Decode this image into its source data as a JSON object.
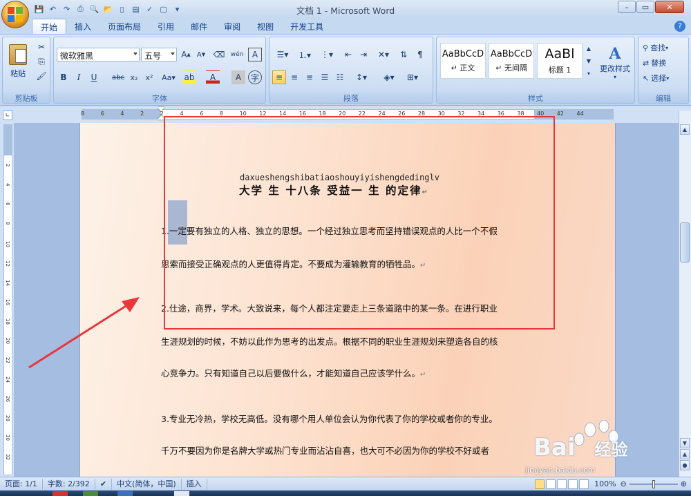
{
  "window": {
    "title": "文档 1 - Microsoft Word"
  },
  "quick_access": {
    "icons": [
      "save-icon",
      "undo-icon",
      "redo-icon",
      "print-icon",
      "print-preview-icon",
      "open-icon",
      "new-icon",
      "doc-icon",
      "spell-icon",
      "page-icon",
      "options-icon"
    ]
  },
  "tabs": [
    "开始",
    "插入",
    "页面布局",
    "引用",
    "邮件",
    "审阅",
    "视图",
    "开发工具"
  ],
  "active_tab": "开始",
  "ribbon": {
    "clipboard": {
      "label": "剪贴板",
      "paste": "粘贴"
    },
    "font": {
      "label": "字体",
      "font_name": "微软雅黑",
      "font_size": "五号"
    },
    "paragraph": {
      "label": "段落"
    },
    "styles": {
      "label": "样式",
      "items": [
        {
          "preview": "AaBbCcD",
          "name": "↵ 正文"
        },
        {
          "preview": "AaBbCcD",
          "name": "↵ 无间隔"
        },
        {
          "preview": "AaBl",
          "name": "标题 1"
        }
      ],
      "change_styles": "更改样式"
    },
    "editing": {
      "label": "编辑",
      "find": "查找",
      "replace": "替换",
      "select": "选择"
    }
  },
  "ruler": {
    "ticks": [
      "8",
      "6",
      "4",
      "2",
      "2",
      "4",
      "6",
      "8",
      "10",
      "12",
      "14",
      "16",
      "18",
      "20",
      "22",
      "24",
      "26",
      "28",
      "30",
      "32",
      "34",
      "36",
      "38",
      "40",
      "42",
      "44"
    ]
  },
  "document": {
    "pinyin": "daxueshengshibatiaoshouyiyishengdedinglv",
    "title": "大学 生 十八条 受益一 生 的定律",
    "para1_line1": "1.一定要有独立的人格、独立的思想。一个经过独立思考而坚持错误观点的人比一个不假",
    "para1_line2": "思索而接受正确观点的人更值得肯定。不要成为灌输教育的牺牲品。",
    "para2_line1": "2.仕途，商界，学术。大致说来，每个人都注定要走上三条道路中的某一条。在进行职业",
    "para2_line2": "生涯规划的时候，不妨以此作为思考的出发点。根据不同的职业生涯规划来塑造各自的核",
    "para2_line3": "心竞争力。只有知道自己以后要做什么，才能知道自己应该学什么。",
    "para3_line1": "3.专业无冷热，学校无高低。没有哪个用人单位会认为你代表了你的学校或者你的专业。",
    "para3_line2": "千万不要因为你是名牌大学或热门专业而沾沾自喜，也大可不必因为你的学校不好或者",
    "para_mark": "↵"
  },
  "status": {
    "page": "页面: 1/1",
    "words": "字数: 2/392",
    "language": "中文(简体，中国)",
    "mode": "插入",
    "zoom": "100%"
  },
  "watermark": {
    "brand": "Bai",
    "brand_suffix": "经验",
    "url": "jingyan.baidu.com"
  },
  "colors": {
    "annotation_red": "#e8363a",
    "ribbon_blue": "#15428b"
  }
}
